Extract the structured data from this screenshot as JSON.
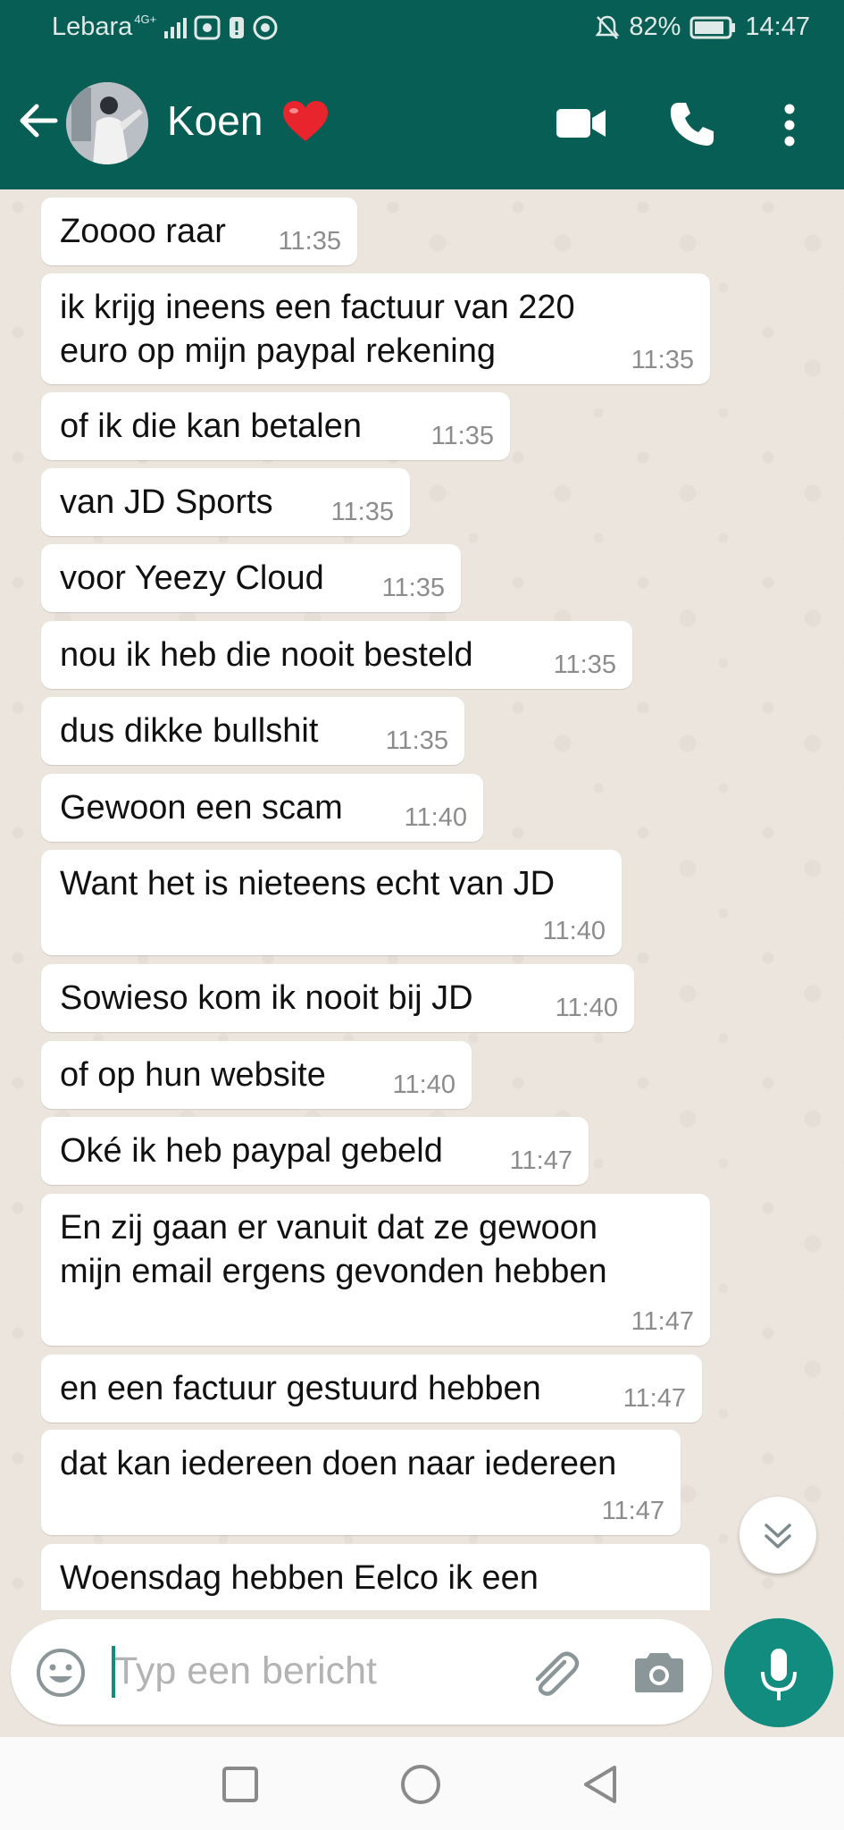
{
  "status_bar": {
    "carrier": "Lebara",
    "network": "4G+",
    "battery": "82%",
    "time": "14:47"
  },
  "header": {
    "contact_name": "Koen",
    "heart_emoji": "❤️"
  },
  "messages": [
    {
      "text": "Zoooo raar",
      "time": "11:35"
    },
    {
      "text": "ik krijg ineens een factuur van 220\neuro op mijn paypal rekening",
      "time": "11:35"
    },
    {
      "text": "of ik die kan betalen",
      "time": "11:35"
    },
    {
      "text": "van JD Sports",
      "time": "11:35"
    },
    {
      "text": "voor Yeezy Cloud",
      "time": "11:35"
    },
    {
      "text": "nou ik heb die nooit besteld",
      "time": "11:35"
    },
    {
      "text": "dus dikke bullshit",
      "time": "11:35"
    },
    {
      "text": "Gewoon een scam",
      "time": "11:40"
    },
    {
      "text": "Want het is nieteens echt van JD",
      "time": "11:40"
    },
    {
      "text": "Sowieso kom ik nooit bij JD",
      "time": "11:40"
    },
    {
      "text": "of op hun website",
      "time": "11:40"
    },
    {
      "text": "Oké ik heb paypal gebeld",
      "time": "11:47"
    },
    {
      "text": "En zij gaan er vanuit dat ze gewoon\nmijn email ergens gevonden hebben",
      "time": "11:47"
    },
    {
      "text": "en een factuur gestuurd hebben",
      "time": "11:47"
    },
    {
      "text": "dat kan iedereen doen naar iedereen",
      "time": "11:47"
    },
    {
      "text": "Woensdag hebben Eelco ik een",
      "time": ""
    }
  ],
  "composer": {
    "placeholder": "Typ een bericht"
  },
  "colors": {
    "header": "#075e54",
    "accent": "#128c7e",
    "chat_background": "#ece5dd",
    "bubble": "#ffffff"
  },
  "icons": [
    "back-arrow-icon",
    "video-call-icon",
    "phone-icon",
    "more-options-icon",
    "emoji-icon",
    "attach-icon",
    "camera-icon",
    "mic-icon",
    "scroll-down-icon",
    "nav-recents-icon",
    "nav-home-icon",
    "nav-back-icon"
  ]
}
